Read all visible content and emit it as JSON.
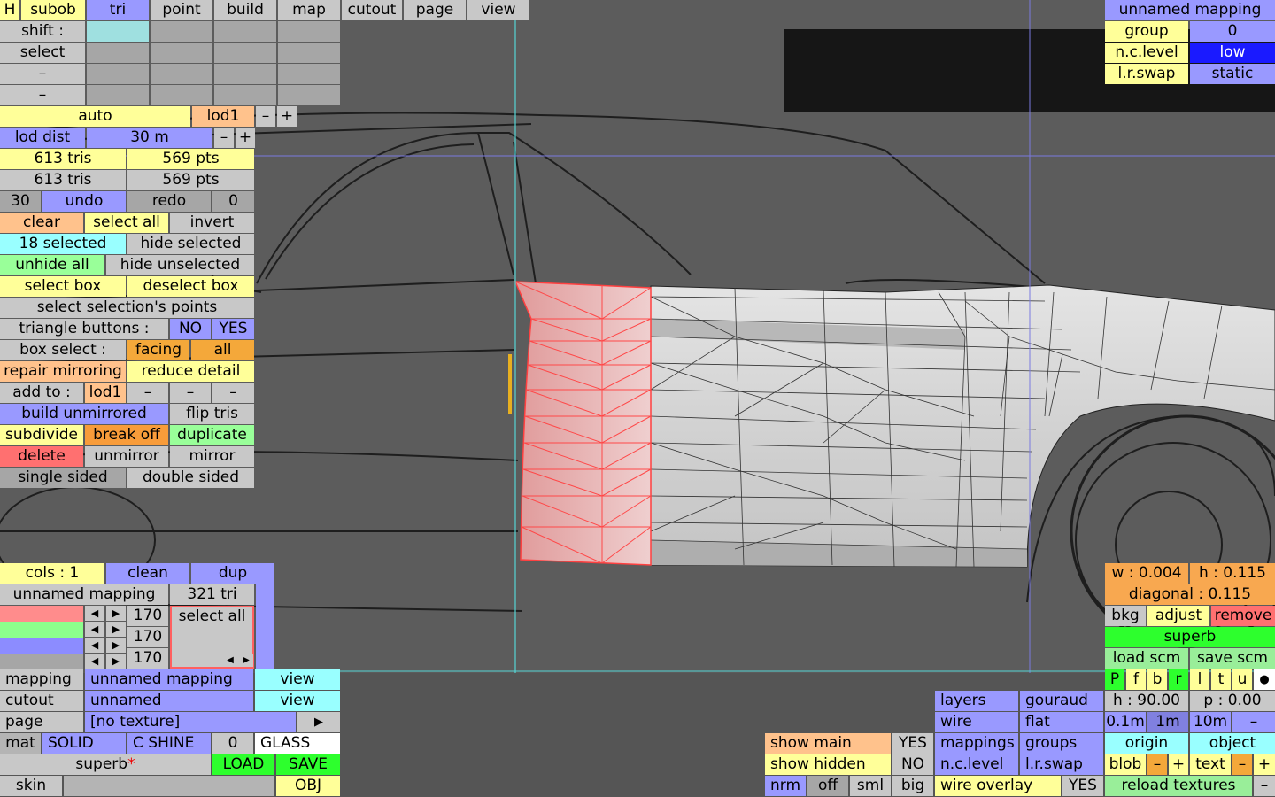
{
  "top_menu": [
    "H",
    "subob",
    "tri",
    "point",
    "build",
    "map",
    "cutout",
    "page",
    "view"
  ],
  "shift_label": "shift :",
  "select_label": "select",
  "dash": "–",
  "auto": "auto",
  "lod1": "lod1",
  "minus": "–",
  "plus": "+",
  "lod_dist_label": "lod dist",
  "lod_dist_value": "30 m",
  "tris_a": "613 tris",
  "pts_a": "569 pts",
  "tris_b": "613 tris",
  "pts_b": "569 pts",
  "undo_count": "30",
  "undo": "undo",
  "redo": "redo",
  "redo_count": "0",
  "clear": "clear",
  "select_all": "select all",
  "invert": "invert",
  "selected_count": "18 selected",
  "hide_selected": "hide selected",
  "unhide_all": "unhide all",
  "hide_unselected": "hide unselected",
  "select_box": "select box",
  "deselect_box": "deselect box",
  "select_sel_points": "select selection's points",
  "triangle_buttons": "triangle buttons :",
  "no": "NO",
  "yes": "YES",
  "box_select": "box select :",
  "facing": "facing",
  "all": "all",
  "repair_mirroring": "repair mirroring",
  "reduce_detail": "reduce detail",
  "add_to": "add to :",
  "add_lod1": "lod1",
  "build_unmirrored": "build unmirrored",
  "flip_tris": "flip tris",
  "subdivide": "subdivide",
  "break_off": "break off",
  "duplicate": "duplicate",
  "delete": "delete",
  "unmirror": "unmirror",
  "mirror": "mirror",
  "single_sided": "single sided",
  "double_sided": "double sided",
  "mapping_panel": {
    "title": "unnamed mapping",
    "group_label": "group",
    "group_value": "0",
    "nclevel_label": "n.c.level",
    "nclevel_value": "low",
    "lrswap_label": "l.r.swap",
    "lrswap_value": "static"
  },
  "cols": "cols : 1",
  "clean": "clean",
  "dup": "dup",
  "unnamed_mapping": "unnamed mapping",
  "tri_count": "321 tri",
  "swatch_values": [
    "170",
    "170",
    "170"
  ],
  "swatch_select_all": "select all",
  "mapping_label": "mapping",
  "mapping_value": "unnamed mapping",
  "view": "view",
  "cutout_label": "cutout",
  "cutout_value": "unnamed",
  "page_label": "page",
  "page_value": "[no texture]",
  "mat": "mat",
  "solid": "SOLID",
  "cshine": "C SHINE",
  "zero": "0",
  "glass": "GLASS",
  "superb_file": "superb",
  "star": "*",
  "load": "LOAD",
  "save": "SAVE",
  "skin": "skin",
  "obj": "OBJ",
  "dims": {
    "w": "w : 0.004",
    "h": "h : 0.115",
    "diagonal": "diagonal : 0.115"
  },
  "bkg": "bkg",
  "adjust": "adjust",
  "remove": "remove",
  "superb": "superb",
  "load_scm": "load scm",
  "save_scm": "save scm",
  "pfbrltu": [
    "P",
    "f",
    "b",
    "r",
    "l",
    "t",
    "u"
  ],
  "dot": "●",
  "layers": "layers",
  "gouraud": "gouraud",
  "h_angle": "h : 90.00",
  "p_angle": "p : 0.00",
  "wire": "wire",
  "flat": "flat",
  "step_01": "0.1m",
  "step_1": "1m",
  "step_10": "10m",
  "show_main": "show main",
  "show_main_val": "YES",
  "mappings": "mappings",
  "groups": "groups",
  "origin": "origin",
  "object": "object",
  "show_hidden": "show hidden",
  "show_hidden_val": "NO",
  "nclevel": "n.c.level",
  "lrswap": "l.r.swap",
  "blob": "blob",
  "text": "text",
  "nrm": "nrm",
  "off": "off",
  "sml": "sml",
  "big": "big",
  "wire_overlay": "wire overlay",
  "wire_overlay_val": "YES",
  "reload_textures": "reload textures",
  "colors": {
    "yellow": "#ffff99",
    "blue": "#9999ff",
    "orange": "#ffc28c",
    "cyan": "#99ffff",
    "green": "#99ff99",
    "bright_green": "#2dff2d",
    "red": "#ff7070",
    "selection": "#ff4040"
  }
}
